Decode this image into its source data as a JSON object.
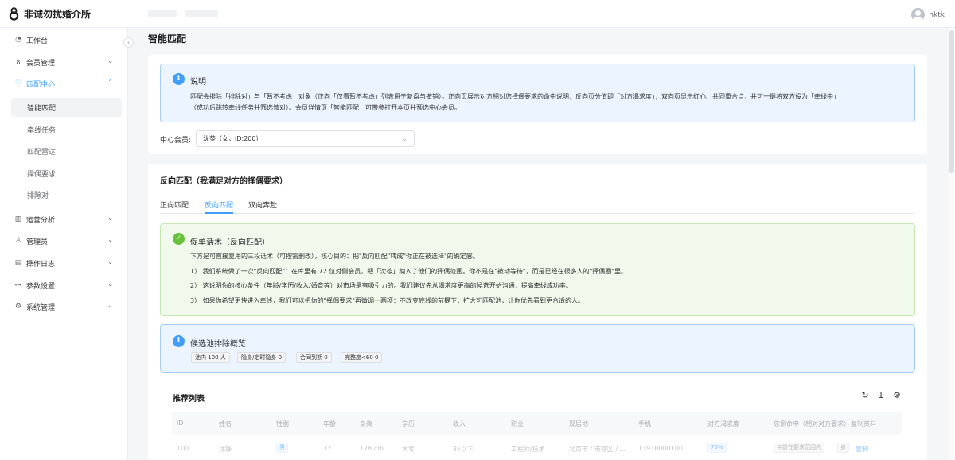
{
  "app": {
    "title": "非诚勿扰婚介所",
    "user": "hktk"
  },
  "sidebar": {
    "items": [
      {
        "label": "工作台",
        "icon": "dashboard-icon"
      },
      {
        "label": "会员管理",
        "icon": "members-icon"
      },
      {
        "label": "匹配中心",
        "icon": "heart-icon"
      },
      {
        "label": "运营分析",
        "icon": "chart-icon"
      },
      {
        "label": "管理员",
        "icon": "user-icon"
      },
      {
        "label": "操作日志",
        "icon": "log-icon"
      },
      {
        "label": "参数设置",
        "icon": "sliders-icon"
      },
      {
        "label": "系统管理",
        "icon": "gear-icon"
      }
    ],
    "sub_items": [
      "智能匹配",
      "牵线任务",
      "匹配雷达",
      "择偶要求",
      "排除对"
    ]
  },
  "page": {
    "title": "智能匹配"
  },
  "notice": {
    "title": "说明",
    "line1": "匹配会排除「排除对」与「暂不考虑」对象（正向「仅看暂不考虑」列表用于复盘与撤销）。正向页展示对方相对您择偶要求的命中说明；反向页分值即「对方渴求度」；双向页显示红心、共同重合点，并可一键将双方设为「牵线中」",
    "line2": "（成功后跳转牵线任务并筛选该对）。会员详情页「智能匹配」可带参打开本页并预选中心会员。"
  },
  "member_select": {
    "label": "中心会员:",
    "value": "沈苓（女，ID:200）"
  },
  "section": {
    "title": "反向匹配（我满足对方的择偶要求）"
  },
  "tabs": [
    "正向匹配",
    "反向匹配",
    "双向奔赴"
  ],
  "script_alert": {
    "title": "促单话术（反向匹配）",
    "lines": [
      "下方是可直接复用的三段话术（可按需删改），核心目的：把\"反向匹配\"转成\"你正在被选择\"的确定感。",
      "1） 我们系统做了一次\"反向匹配\"：在库里有 72 位对侧会员，把「沈苓」纳入了他们的择偶范围。你不是在\"被动等待\"，而是已经在很多人的\"择偶圈\"里。",
      "2） 这说明你的核心条件（年龄/学历/收入/婚育等）对市场是有吸引力的。我们建议先从渴求度更高的候选开始沟通，提高牵线成功率。",
      "3） 如果你希望更快进入牵线，我们可以把你的\"择偶要求\"再微调一两项：不改变底线的前提下，扩大可匹配池，让你优先看到更合适的人。"
    ]
  },
  "pool_alert": {
    "title": "候选池排除概览",
    "tags": [
      "池内 100 人",
      "隐身/定时隐身 0",
      "合同到期 0",
      "完整度<60 0"
    ]
  },
  "list": {
    "title": "推荐列表",
    "columns": [
      "ID",
      "姓名",
      "性别",
      "年龄",
      "身高",
      "学历",
      "收入",
      "职业",
      "现居地",
      "手机",
      "对方渴求度",
      "您侧命中（相对对方要求）",
      "复制资料"
    ],
    "rows": [
      {
        "id": "100",
        "name": "沈铎",
        "gender": "男",
        "age": "37",
        "height": "178 cm",
        "education": "大专",
        "income": "3k以下",
        "job": "工程师/技术",
        "location": "北京市 / 市辖区 / ...",
        "phone": "13910000100",
        "desire": "79%",
        "hit": "年龄在要求范围内",
        "hit_extra": "身",
        "copy": "复制"
      }
    ]
  }
}
